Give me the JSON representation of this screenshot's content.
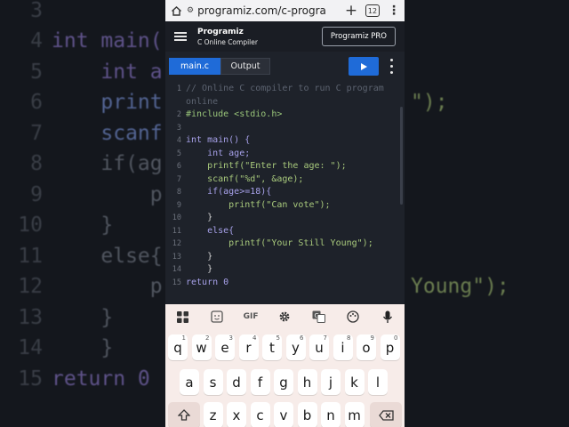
{
  "background": {
    "lines": [
      {
        "num": "3",
        "code": ""
      },
      {
        "num": "4",
        "code": "int main("
      },
      {
        "num": "5",
        "code": "    int a"
      },
      {
        "num": "6",
        "code": "    print"
      },
      {
        "num": "7",
        "code": "    scanf"
      },
      {
        "num": "8",
        "code": "    if(ag"
      },
      {
        "num": "9",
        "code": "        p"
      },
      {
        "num": "10",
        "code": "    }"
      },
      {
        "num": "11",
        "code": "    else{"
      },
      {
        "num": "12",
        "code": "        p"
      },
      {
        "num": "13",
        "code": "    }"
      },
      {
        "num": "14",
        "code": "    }"
      },
      {
        "num": "15",
        "code": "return 0"
      }
    ],
    "right_fragments": [
      "\");",
      "Young\");"
    ]
  },
  "browser": {
    "url": "programiz.com/c-progra",
    "tab_count": "12"
  },
  "header": {
    "logo_text": "Programiz",
    "subtitle": "C Online Compiler",
    "pro_button": "Programiz PRO"
  },
  "toolbar": {
    "file_tab": "main.c",
    "output_tab": "Output"
  },
  "editor": {
    "lines": [
      {
        "num": "1",
        "code": "// Online C compiler to run C program"
      },
      {
        "num": "",
        "code": "online"
      },
      {
        "num": "2",
        "code": "#include <stdio.h>"
      },
      {
        "num": "3",
        "code": ""
      },
      {
        "num": "4",
        "code": "int main() {"
      },
      {
        "num": "5",
        "code": "    int age;"
      },
      {
        "num": "6",
        "code": "    printf(\"Enter the age: \");"
      },
      {
        "num": "7",
        "code": "    scanf(\"%d\", &age);"
      },
      {
        "num": "8",
        "code": "    if(age>=18){"
      },
      {
        "num": "9",
        "code": "        printf(\"Can vote\");"
      },
      {
        "num": "10",
        "code": "    }"
      },
      {
        "num": "11",
        "code": "    else{"
      },
      {
        "num": "12",
        "code": "        printf(\"Your Still Young\");"
      },
      {
        "num": "13",
        "code": "    }"
      },
      {
        "num": "14",
        "code": "    }"
      },
      {
        "num": "15",
        "code": "return 0"
      }
    ]
  },
  "keyboard": {
    "toolbar": {
      "gif_label": "GIF"
    },
    "row1": [
      {
        "key": "q",
        "sub": "1"
      },
      {
        "key": "w",
        "sub": "2"
      },
      {
        "key": "e",
        "sub": "3"
      },
      {
        "key": "r",
        "sub": "4"
      },
      {
        "key": "t",
        "sub": "5"
      },
      {
        "key": "y",
        "sub": "6"
      },
      {
        "key": "u",
        "sub": "7"
      },
      {
        "key": "i",
        "sub": "8"
      },
      {
        "key": "o",
        "sub": "9"
      },
      {
        "key": "p",
        "sub": "0"
      }
    ],
    "row2": [
      "a",
      "s",
      "d",
      "f",
      "g",
      "h",
      "j",
      "k",
      "l"
    ],
    "row3": [
      "z",
      "x",
      "c",
      "v",
      "b",
      "n",
      "m"
    ]
  },
  "colors": {
    "accent": "#1f6bd8",
    "editor_bg": "#1e222a",
    "keyboard_bg": "#f7ece9"
  }
}
